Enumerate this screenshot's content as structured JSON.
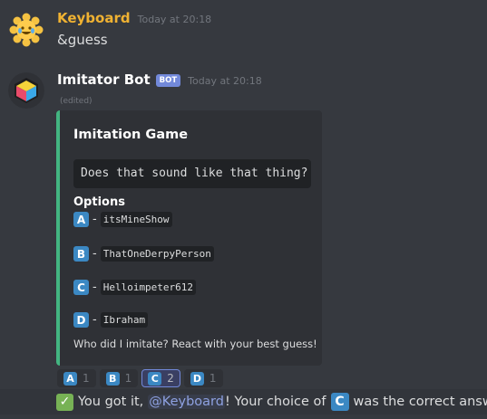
{
  "messages": {
    "user": {
      "username": "Keyboard",
      "username_color": "#f0b232",
      "timestamp": "Today at 20:18",
      "text": "&guess"
    },
    "bot": {
      "username": "Imitator Bot",
      "username_color": "#ffffff",
      "bot_tag": "BOT",
      "timestamp": "Today at 20:18",
      "edited": "(edited)"
    }
  },
  "embed": {
    "accent_color": "#43b581",
    "title": "Imitation Game",
    "question": "Does that sound like that thing?",
    "field_name": "Options",
    "options": [
      {
        "letter": "A",
        "dash": "-",
        "name": "itsMineShow"
      },
      {
        "letter": "B",
        "dash": "-",
        "name": "ThatOneDerpyPerson"
      },
      {
        "letter": "C",
        "dash": "-",
        "name": "Helloimpeter612"
      },
      {
        "letter": "D",
        "dash": "-",
        "name": "Ibraham"
      }
    ],
    "footer_text": "Who did I imitate? React with your best guess!"
  },
  "reactions": [
    {
      "letter": "A",
      "count": "1",
      "active": false
    },
    {
      "letter": "B",
      "count": "1",
      "active": false
    },
    {
      "letter": "C",
      "count": "2",
      "active": true
    },
    {
      "letter": "D",
      "count": "1",
      "active": false
    }
  ],
  "result": {
    "check_icon": "white-check-mark-icon",
    "prefix": "You got it,",
    "mention": "@Keyboard",
    "middle": "! Your choice of",
    "letter": "C",
    "suffix": "was the correct answer."
  },
  "colors": {
    "background": "#36393f",
    "embed_background": "#2f3136",
    "regional_indicator": "#3b88c3",
    "mention": "#8ea1e1",
    "bot_tag": "#7289da"
  }
}
